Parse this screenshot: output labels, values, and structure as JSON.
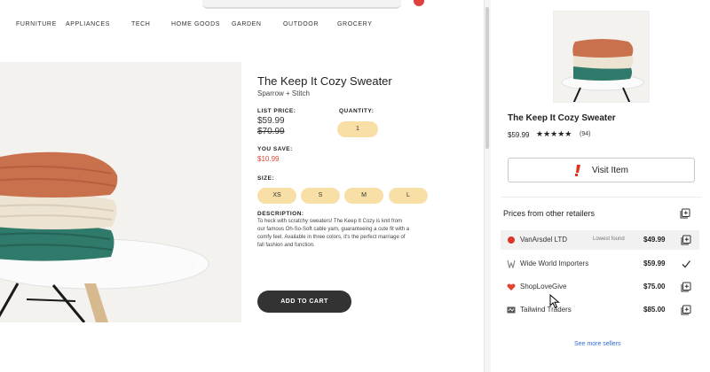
{
  "nav": {
    "items": [
      "FURNITURE",
      "APPLIANCES",
      "TECH",
      "HOME GOODS",
      "GARDEN",
      "OUTDOOR",
      "GROCERY"
    ]
  },
  "product": {
    "title": "The Keep It Cozy Sweater",
    "brand": "Sparrow + Stitch",
    "list_price_label": "LIST PRICE:",
    "price": "$59.99",
    "old_price": "$70.99",
    "quantity_label": "QUANTITY:",
    "quantity": "1",
    "you_save_label": "YOU SAVE:",
    "you_save": "$10.99",
    "size_label": "SIZE:",
    "sizes": [
      "XS",
      "S",
      "M",
      "L"
    ],
    "description_label": "DESCRIPTION:",
    "description": "To heck with scratchy sweaters! The Keep It Cozy is knit from our famous Oh-So-Soft cable yarn, guaranteeing a cute fit with a comfy feel. Available in three colors, it's the perfect marriage of fall fashion and function.",
    "add_to_cart": "ADD TO CART"
  },
  "panel": {
    "title": "The Keep It Cozy Sweater",
    "price": "$59.99",
    "stars": "★★★★★",
    "rating": 5,
    "review_count": "(94)",
    "visit_label": "Visit Item",
    "other_retailers_title": "Prices from other retailers",
    "retailers": [
      {
        "name": "VanArsdel LTD",
        "note": "Lowest found",
        "price": "$49.99",
        "action": "add-to-collection-icon"
      },
      {
        "name": "Wide World Importers",
        "note": "",
        "price": "$59.99",
        "action": "checkmark-icon"
      },
      {
        "name": "ShopLoveGive",
        "note": "",
        "price": "$75.00",
        "action": "add-to-collection-icon"
      },
      {
        "name": "Tailwind Traders",
        "note": "",
        "price": "$85.00",
        "action": "add-to-collection-icon"
      }
    ],
    "see_more": "See more sellers"
  },
  "colors": {
    "accent_yellow": "#f7dfa6",
    "save_red": "#d94a3a",
    "link_blue": "#2f6fd6",
    "cart_dark": "#333333"
  }
}
